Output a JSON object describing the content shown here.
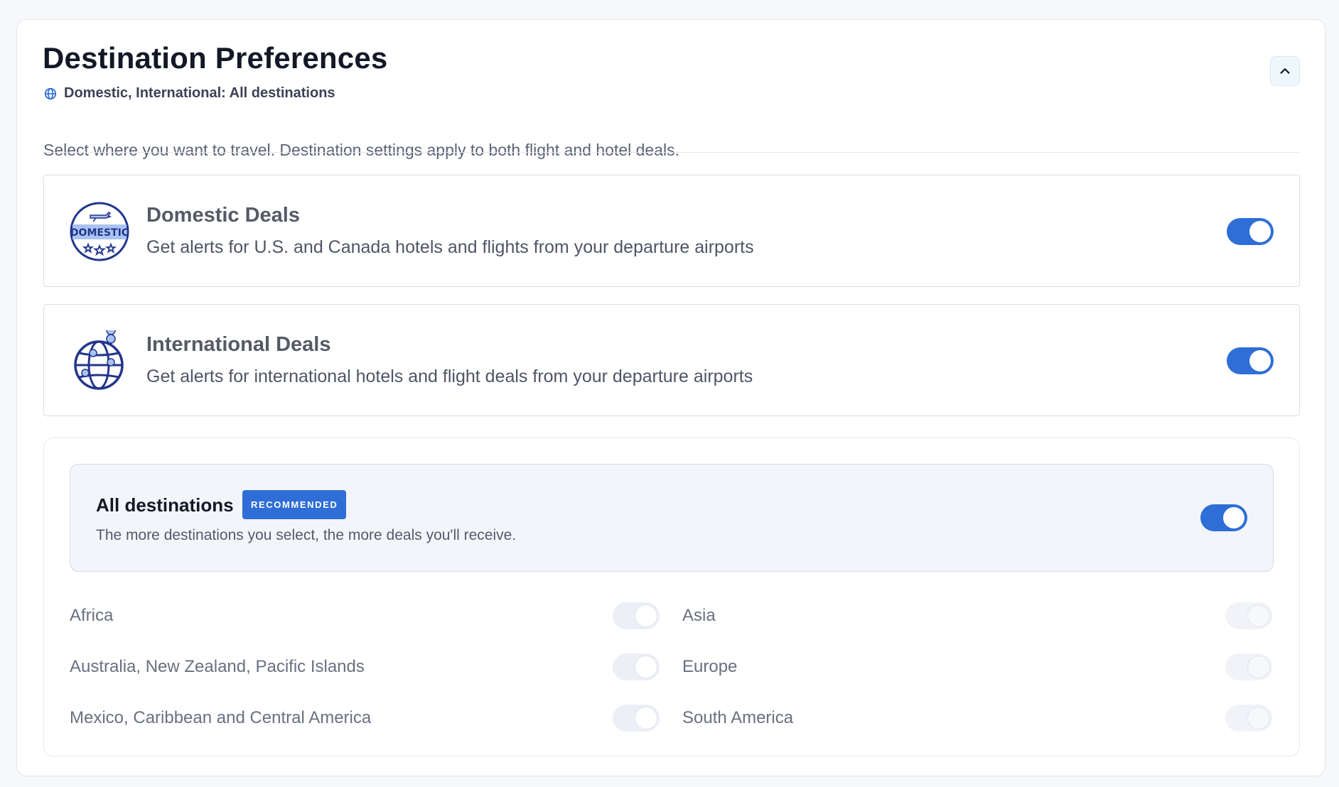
{
  "header": {
    "title": "Destination Preferences",
    "subtitle": "Domestic, International: All destinations",
    "subtitle_icon": "globe-icon",
    "collapse_icon": "chevron-up-icon",
    "description": "Select where you want to travel. Destination settings apply to both flight and hotel deals."
  },
  "domestic": {
    "title": "Domestic Deals",
    "description": "Get alerts for U.S. and Canada hotels and flights from your departure airports",
    "icon": "domestic-badge-icon",
    "badge_text": "DOMESTIC",
    "enabled": true
  },
  "international": {
    "title": "International Deals",
    "description": "Get alerts for international hotels and flight deals from your departure airports",
    "icon": "globe-pins-icon",
    "enabled": true
  },
  "all_destinations": {
    "title": "All destinations",
    "badge": "RECOMMENDED",
    "description": "The more destinations you select, the more deals you'll receive.",
    "enabled": true
  },
  "regions": [
    {
      "label": "Africa",
      "enabled": false
    },
    {
      "label": "Asia",
      "enabled": false
    },
    {
      "label": "Australia, New Zealand, Pacific Islands",
      "enabled": false
    },
    {
      "label": "Europe",
      "enabled": false
    },
    {
      "label": "Mexico, Caribbean and Central America",
      "enabled": false
    },
    {
      "label": "South America",
      "enabled": false
    }
  ],
  "colors": {
    "accent": "#2e6ed6",
    "icon_navy": "#22368c",
    "icon_light": "#a9c4f2"
  }
}
